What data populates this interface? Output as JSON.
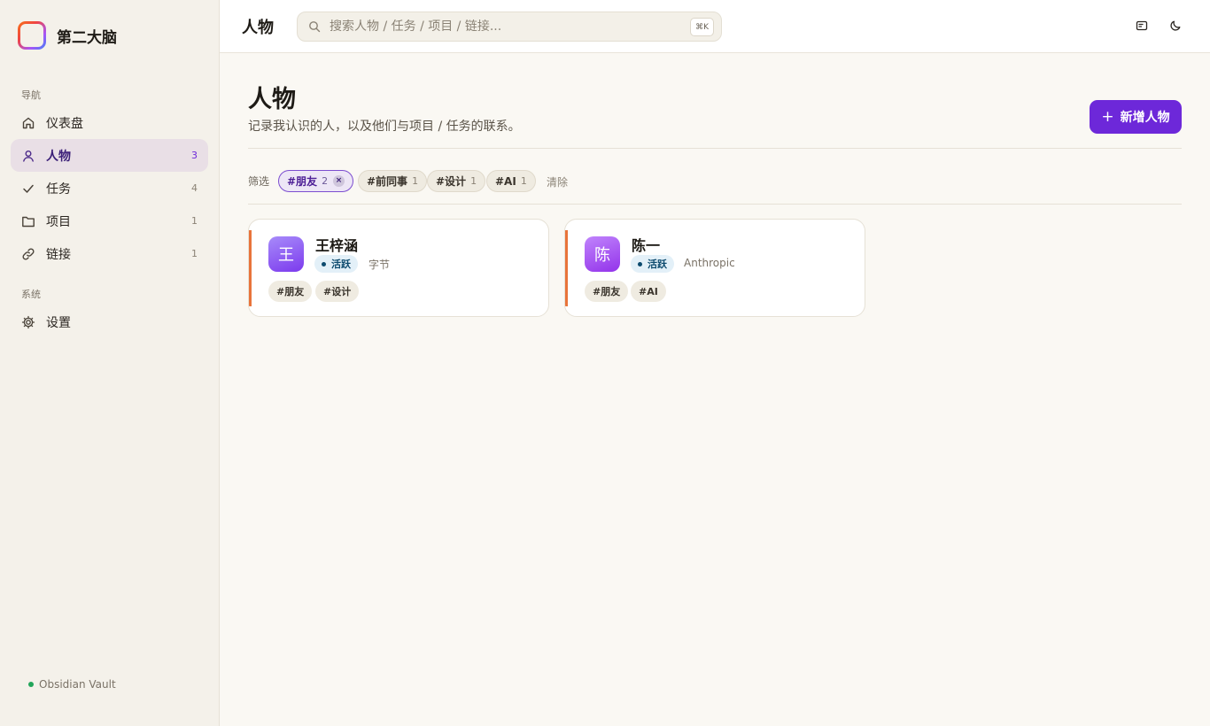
{
  "app": {
    "name": "第二大脑",
    "vault_label": "Obsidian Vault"
  },
  "sidebar": {
    "nav_section": "导航",
    "system_section": "系统",
    "items": [
      {
        "label": "仪表盘",
        "count": "",
        "icon": "home-icon"
      },
      {
        "label": "人物",
        "count": "3",
        "icon": "person-icon",
        "active": true
      },
      {
        "label": "任务",
        "count": "4",
        "icon": "check-icon"
      },
      {
        "label": "项目",
        "count": "1",
        "icon": "folder-icon"
      },
      {
        "label": "链接",
        "count": "1",
        "icon": "link-icon"
      }
    ],
    "settings": {
      "label": "设置",
      "icon": "gear-icon"
    }
  },
  "topbar": {
    "title": "人物",
    "search_placeholder": "搜索人物 / 任务 / 项目 / 链接...",
    "shortcut": "⌘K"
  },
  "page": {
    "title": "人物",
    "subtitle": "记录我认识的人，以及他们与项目 / 任务的联系。",
    "add_button": "新增人物"
  },
  "filters": {
    "label": "筛选",
    "chips": [
      {
        "label": "#朋友",
        "count": "2",
        "active": true
      },
      {
        "label": "#前同事",
        "count": "1"
      },
      {
        "label": "#设计",
        "count": "1"
      },
      {
        "label": "#AI",
        "count": "1"
      }
    ],
    "clear": "清除"
  },
  "people": [
    {
      "initial": "王",
      "name": "王梓涵",
      "status": "活跃",
      "company": "字节",
      "tags": [
        "#朋友",
        "#设计"
      ]
    },
    {
      "initial": "陈",
      "name": "陈一",
      "status": "活跃",
      "company": "Anthropic",
      "tags": [
        "#朋友",
        "#AI"
      ]
    }
  ],
  "colors": {
    "accent": "#6d28d9",
    "card_accent": "#e8743b",
    "status_active_bg": "#e3f0f8",
    "status_active_fg": "#0c4a6e",
    "vault_dot": "#22a55a"
  }
}
